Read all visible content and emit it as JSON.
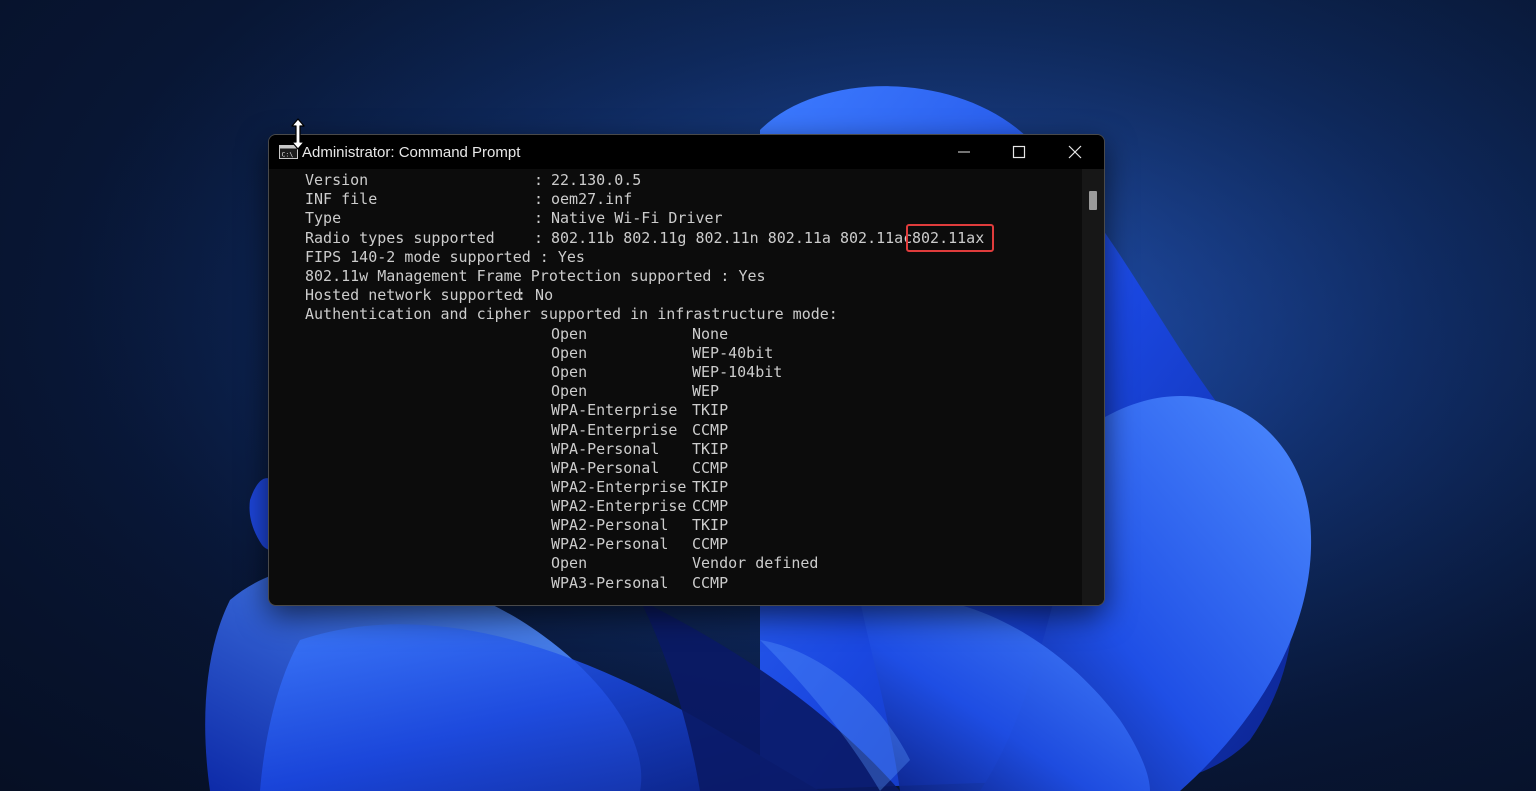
{
  "window": {
    "title": "Administrator: Command Prompt",
    "icon": "command-prompt-icon"
  },
  "controls": {
    "minimize": "minimize-icon",
    "maximize": "maximize-icon",
    "close": "close-icon"
  },
  "console": {
    "properties": [
      {
        "label": "Version",
        "value": "22.130.0.5"
      },
      {
        "label": "INF file",
        "value": "oem27.inf"
      },
      {
        "label": "Type",
        "value": "Native Wi-Fi Driver"
      },
      {
        "label": "Radio types supported",
        "value": "802.11b 802.11g 802.11n 802.11a 802.11ac",
        "highlighted": "802.11ax"
      }
    ],
    "fips": "FIPS 140-2 mode supported : Yes",
    "mfp": "802.11w Management Frame Protection supported : Yes",
    "hosted_label": "Hosted network supported",
    "hosted_value": ": No",
    "auth_header": "Authentication and cipher supported in infrastructure mode:",
    "auth": [
      {
        "auth": "Open",
        "cipher": "None"
      },
      {
        "auth": "Open",
        "cipher": "WEP-40bit"
      },
      {
        "auth": "Open",
        "cipher": "WEP-104bit"
      },
      {
        "auth": "Open",
        "cipher": "WEP"
      },
      {
        "auth": "WPA-Enterprise",
        "cipher": "TKIP"
      },
      {
        "auth": "WPA-Enterprise",
        "cipher": "CCMP"
      },
      {
        "auth": "WPA-Personal",
        "cipher": "TKIP"
      },
      {
        "auth": "WPA-Personal",
        "cipher": "CCMP"
      },
      {
        "auth": "WPA2-Enterprise",
        "cipher": "TKIP"
      },
      {
        "auth": "WPA2-Enterprise",
        "cipher": "CCMP"
      },
      {
        "auth": "WPA2-Personal",
        "cipher": "TKIP"
      },
      {
        "auth": "WPA2-Personal",
        "cipher": "CCMP"
      },
      {
        "auth": "Open",
        "cipher": "Vendor defined"
      },
      {
        "auth": "WPA3-Personal",
        "cipher": "CCMP"
      }
    ],
    "separator": ":"
  },
  "colors": {
    "highlight_border": "#e03c3c",
    "console_text": "#cccccc",
    "console_background": "#0c0c0c"
  }
}
